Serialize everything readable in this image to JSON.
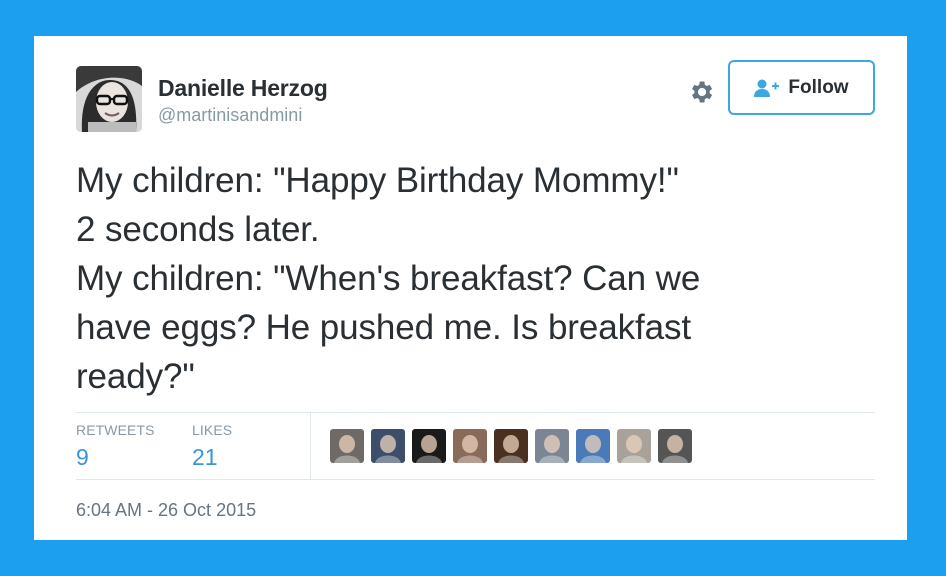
{
  "author": {
    "name": "Danielle Herzog",
    "handle": "@martinisandmini"
  },
  "actions": {
    "follow_label": "Follow"
  },
  "tweet": {
    "lines": [
      "My children: \"Happy Birthday Mommy!\"",
      "2 seconds later.",
      "My children: \"When's breakfast? Can we",
      "have eggs? He pushed me. Is breakfast",
      "ready?\""
    ]
  },
  "stats": {
    "retweets_label": "RETWEETS",
    "retweets_value": "9",
    "likes_label": "LIKES",
    "likes_value": "21"
  },
  "likers": [
    {
      "color": "#6f6a66"
    },
    {
      "color": "#3c4e6a"
    },
    {
      "color": "#1a1a1a"
    },
    {
      "color": "#8a6a58"
    },
    {
      "color": "#4a3020"
    },
    {
      "color": "#7b8594"
    },
    {
      "color": "#4a7ab8"
    },
    {
      "color": "#a8a29a"
    },
    {
      "color": "#555555"
    }
  ],
  "timestamp": "6:04 AM - 26 Oct 2015",
  "colors": {
    "background": "#1d9ff0",
    "accent": "#3b94d9",
    "text": "#292f33",
    "muted": "#8899a6",
    "follow_border": "#3ba9e0"
  }
}
